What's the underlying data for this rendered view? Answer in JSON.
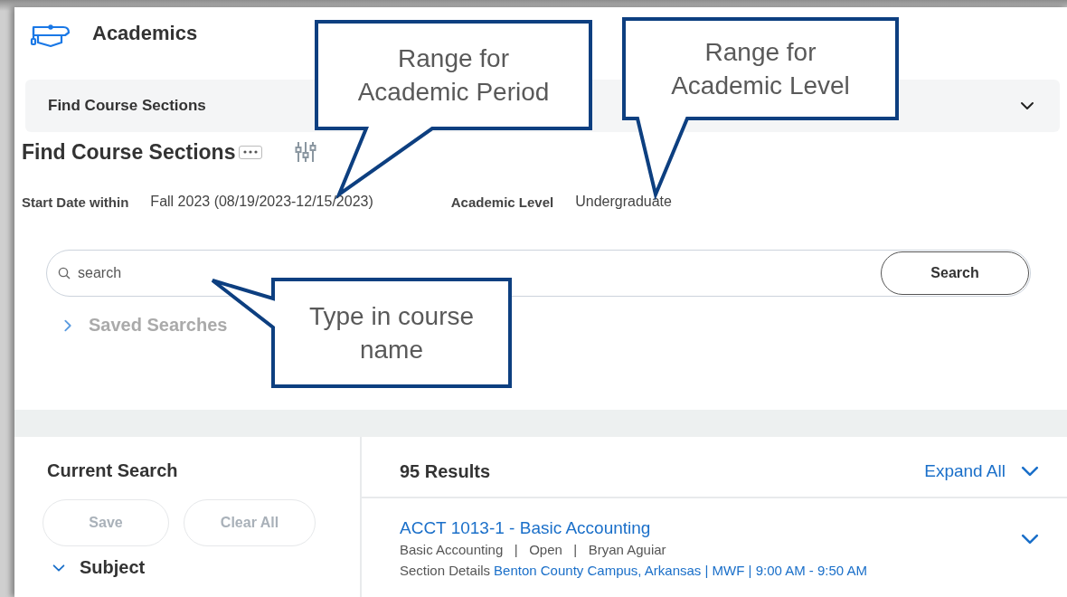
{
  "app": {
    "title": "Academics"
  },
  "task_bar": {
    "title": "Find Course Sections"
  },
  "page": {
    "heading": "Find Course Sections"
  },
  "criteria": [
    {
      "label": "Start Date within",
      "value": "Fall 2023 (08/19/2023-12/15/2023)"
    },
    {
      "label": "Academic Level",
      "value": "Undergraduate"
    }
  ],
  "search": {
    "placeholder": "search",
    "button": "Search"
  },
  "saved_searches": {
    "label": "Saved Searches",
    "expanded": false
  },
  "current_search": {
    "title": "Current Search",
    "buttons": [
      {
        "label": "Save",
        "disabled": true
      },
      {
        "label": "Clear All",
        "disabled": true
      }
    ],
    "facets": [
      {
        "label": "Subject",
        "expanded": true
      }
    ]
  },
  "results": {
    "count": "95 Results",
    "expand_all": "Expand All",
    "items": [
      {
        "title": "ACCT 1013-1 - Basic Accounting",
        "meta": "Basic Accounting   |   Open   |   Bryan Aguiar",
        "details_label": "Section Details",
        "details": "Benton County Campus, Arkansas | MWF | 9:00 AM - 9:50 AM"
      }
    ]
  },
  "callouts": [
    {
      "text": "Range for\nAcademic Period"
    },
    {
      "text": "Range for\nAcademic Level"
    },
    {
      "text": "Type in course\nname"
    }
  ]
}
